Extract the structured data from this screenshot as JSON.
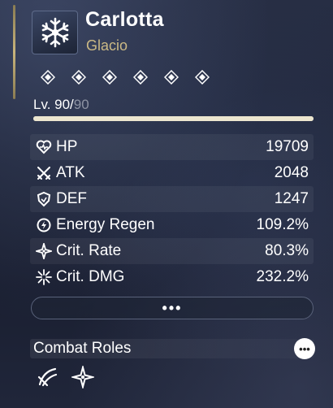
{
  "character": {
    "name": "Carlotta",
    "element": "Glacio",
    "element_icon": "snowflake-icon",
    "level_current": "Lv. 90/",
    "level_max": "90",
    "level_progress": 1.0,
    "sequence_nodes": 6
  },
  "stats": [
    {
      "icon": "hp-icon",
      "label": "HP",
      "value": "19709"
    },
    {
      "icon": "atk-icon",
      "label": "ATK",
      "value": "2048"
    },
    {
      "icon": "def-icon",
      "label": "DEF",
      "value": "1247"
    },
    {
      "icon": "energy-regen-icon",
      "label": "Energy Regen",
      "value": "109.2%"
    },
    {
      "icon": "crit-rate-icon",
      "label": "Crit. Rate",
      "value": "80.3%"
    },
    {
      "icon": "crit-dmg-icon",
      "label": "Crit. DMG",
      "value": "232.2%"
    }
  ],
  "more_button": {
    "label": "•••"
  },
  "combat_roles": {
    "title": "Combat Roles",
    "info_label": "•••",
    "roles": [
      "slash-role-icon",
      "sparkle-role-icon"
    ]
  },
  "colors": {
    "accent_gold": "#cbb985",
    "background": "#1d2336"
  }
}
